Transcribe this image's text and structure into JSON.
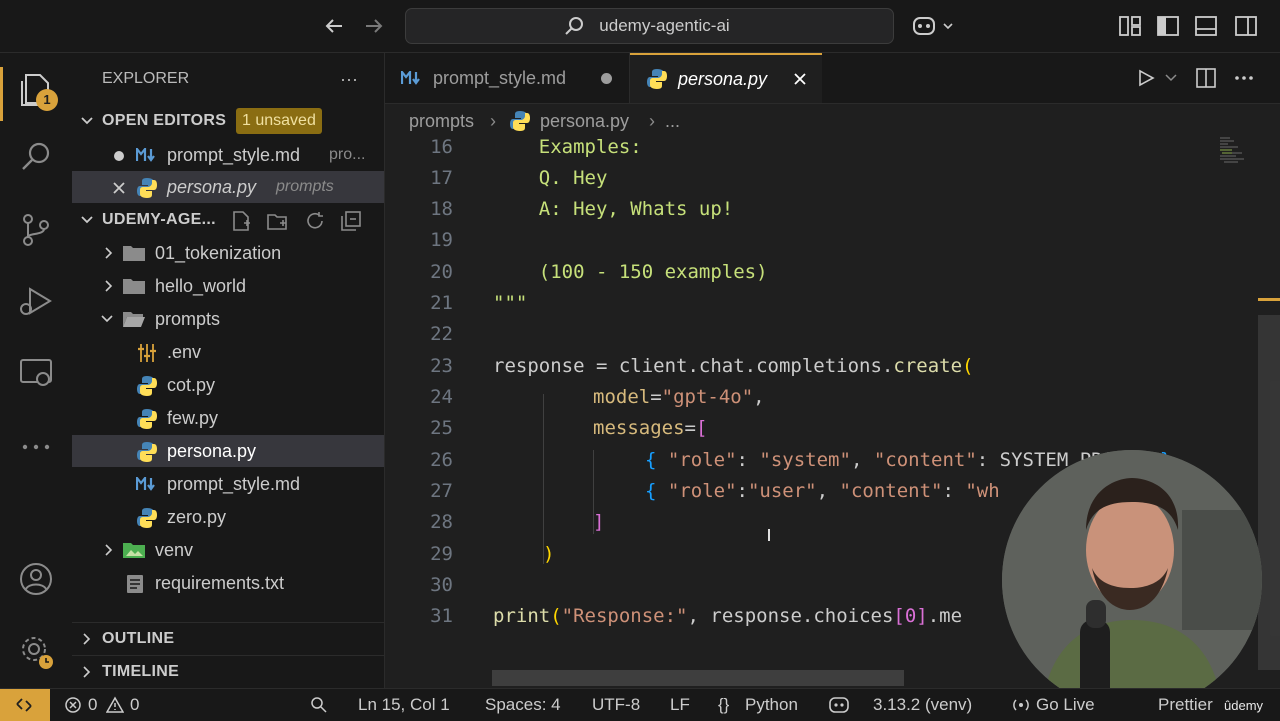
{
  "titlebar": {
    "search_label": "udemy-agentic-ai"
  },
  "activity": {
    "explorer_badge": "1"
  },
  "sidebar": {
    "title": "EXPLORER",
    "more": "···",
    "open_editors": {
      "header": "OPEN EDITORS",
      "unsaved_badge": "1 unsaved",
      "items": [
        {
          "name": "prompt_style.md",
          "desc": "pro..."
        },
        {
          "name": "persona.py",
          "desc": "prompts"
        }
      ]
    },
    "workspace": {
      "header": "UDEMY-AGE...",
      "items": [
        {
          "label": "01_tokenization"
        },
        {
          "label": "hello_world"
        },
        {
          "label": "prompts"
        },
        {
          "label": ".env"
        },
        {
          "label": "cot.py"
        },
        {
          "label": "few.py"
        },
        {
          "label": "persona.py"
        },
        {
          "label": "prompt_style.md"
        },
        {
          "label": "zero.py"
        },
        {
          "label": "venv"
        },
        {
          "label": "requirements.txt"
        }
      ]
    },
    "outline": "OUTLINE",
    "timeline": "TIMELINE"
  },
  "tabs": [
    {
      "label": "prompt_style.md"
    },
    {
      "label": "persona.py"
    }
  ],
  "breadcrumb": {
    "folder": "prompts",
    "file": "persona.py",
    "more": "..."
  },
  "code": {
    "line_numbers": [
      "16",
      "17",
      "18",
      "19",
      "20",
      "21",
      "22",
      "23",
      "24",
      "25",
      "26",
      "27",
      "28",
      "29",
      "30",
      "31"
    ],
    "l16": "    Examples:",
    "l17": "    Q. Hey",
    "l18": "    A: Hey, Whats up!",
    "l20": "    (100 - 150 examples)",
    "l21": "\"\"\"",
    "l23_a": "response",
    "l23_b": " = client.chat.completions.",
    "l23_c": "create",
    "l23_d": "(",
    "l24_a": "model",
    "l24_b": "=",
    "l24_c": "\"gpt-4o\"",
    "l24_d": ",",
    "l25_a": "messages",
    "l25_b": "=",
    "l25_c": "[",
    "l26_a": "{ ",
    "l26_b": "\"role\"",
    "l26_c": ": ",
    "l26_d": "\"system\"",
    "l26_e": ", ",
    "l26_f": "\"content\"",
    "l26_g": ": SYSTEM_PROMPT ",
    "l26_h": "}",
    "l27_a": "{ ",
    "l27_b": "\"role\"",
    "l27_c": ":",
    "l27_d": "\"user\"",
    "l27_e": ", ",
    "l27_f": "\"content\"",
    "l27_g": ": ",
    "l27_h": "\"wh",
    "l28": "]",
    "l29": ")",
    "l31_a": "print",
    "l31_b": "(",
    "l31_c": "\"Response:\"",
    "l31_d": ", response.choices",
    "l31_e": "[0]",
    "l31_f": ".me"
  },
  "statusbar": {
    "errors": "0",
    "warnings": "0",
    "position": "Ln 15, Col 1",
    "spaces": "Spaces: 4",
    "encoding": "UTF-8",
    "eol": "LF",
    "language": "Python",
    "interpreter": "3.13.2 (venv)",
    "golive": "Go Live",
    "prettier": "Prettier"
  },
  "watermark": "ûdemy",
  "colors": {
    "accent": "#d9a23b",
    "docstring": "#c6e07a",
    "string": "#ce9178",
    "function": "#dcdcaa"
  }
}
